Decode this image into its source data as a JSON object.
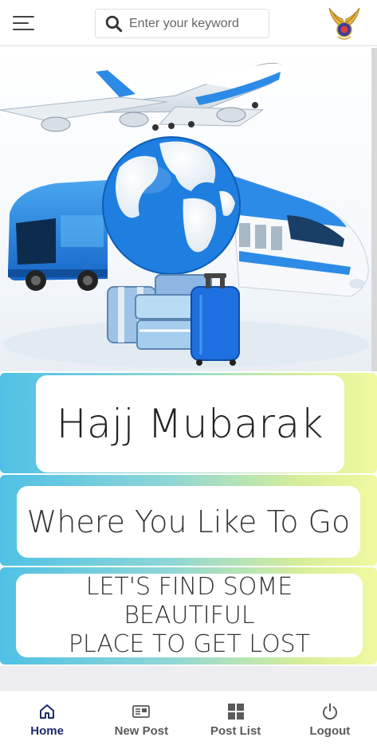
{
  "header": {
    "search": {
      "placeholder": "Enter your keyword",
      "value": ""
    }
  },
  "cards": {
    "title": "Hajj Mubarak",
    "subtitle": "Where You Like To Go",
    "tagline_line1": "LET'S FIND SOME BEAUTIFUL",
    "tagline_line2": "PLACE TO GET LOST"
  },
  "bottom_nav": {
    "items": [
      {
        "label": "Home",
        "icon": "home-icon",
        "active": true
      },
      {
        "label": "New Post",
        "icon": "new-post-icon",
        "active": false
      },
      {
        "label": "Post List",
        "icon": "grid-icon",
        "active": false
      },
      {
        "label": "Logout",
        "icon": "power-icon",
        "active": false
      }
    ]
  },
  "colors": {
    "active_nav": "#1f2a6b",
    "inactive_nav": "#5a5a5a",
    "gradient_start": "#4fc1e6",
    "gradient_end": "#f1f9a0",
    "travel_blue": "#1e88e5"
  }
}
